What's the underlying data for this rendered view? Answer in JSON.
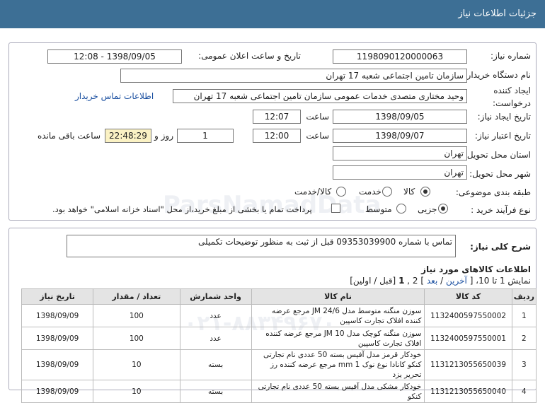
{
  "header": {
    "title": "جزئیات اطلاعات نیاز"
  },
  "form": {
    "need_number_label": "شماره نیاز:",
    "need_number": "1198090120000063",
    "announce_label": "تاریخ و ساعت اعلان عمومی:",
    "announce_value": "1398/09/05 - 12:08",
    "buyer_org_label": "نام دستگاه خریدار:",
    "buyer_org": "سازمان تامین اجتماعی شعبه 17 تهران",
    "creator_label_1": "ایجاد کننده",
    "creator_label_2": "درخواست:",
    "creator": "وحید  مختاری  متصدی خدمات عمومی  سازمان تامین اجتماعی شعبه 17 تهران",
    "contact_link": "اطلاعات تماس خریدار",
    "create_date_label": "تاریخ ایجاد نیاز:",
    "create_date": "1398/09/05",
    "time_label": "ساعت",
    "create_time": "12:07",
    "valid_date_label": "تاریخ اعتبار نیاز:",
    "valid_date": "1398/09/07",
    "valid_time": "12:00",
    "days_value": "1",
    "days_label": "روز و",
    "remaining_time": "22:48:29",
    "remaining_label": "ساعت باقی مانده",
    "province_label": "استان محل تحویل:",
    "province": "تهران",
    "city_label": "شهر محل تحویل:",
    "city": "تهران",
    "category_label": "طبقه بندی موضوعی:",
    "category_options": [
      "کالا",
      "خدمت",
      "کالا/خدمت"
    ],
    "category_selected": "کالا",
    "purchase_label": "نوع فرآیند خرید :",
    "purchase_options": [
      "جزیی",
      "متوسط"
    ],
    "purchase_selected": "جزیی",
    "payment_note": "پرداخت تمام یا بخشی از مبلغ خرید،از محل \"اسناد خزانه اسلامی\" خواهد بود."
  },
  "description": {
    "label": "شرح کلی نیاز:",
    "text": "تماس با شماره 09353039900 قبل از ثبت به منظور توضیحات تکمیلی"
  },
  "items_section": {
    "title": "اطلاعات کالاهای مورد نیاز",
    "pager_prefix": "نمایش 1 تا 10، [",
    "pager_last": "آخرین",
    "pager_sep1": "/",
    "pager_next": "بعد",
    "pager_mid": "] 2 ,",
    "pager_current": "1",
    "pager_suffix": "[قبل / اولین]",
    "columns": [
      "ردیف",
      "کد کالا",
      "نام کالا",
      "واحد شمارش",
      "تعداد / مقدار",
      "تاریخ نیاز"
    ],
    "rows": [
      {
        "row": "1",
        "code": "1132400597550002",
        "name": "سوزن منگنه متوسط مدل JM 24/6 مرجع عرضه کننده افلاک تجارت کاسپین",
        "unit": "عدد",
        "qty": "100",
        "date": "1398/09/09"
      },
      {
        "row": "2",
        "code": "1132400597550001",
        "name": "سوزن منگنه کوچک مدل JM 10 مرجع عرضه کننده افلاک تجارت کاسپین",
        "unit": "عدد",
        "qty": "100",
        "date": "1398/09/09"
      },
      {
        "row": "3",
        "code": "1131213055650039",
        "name": "خودکار قرمز مدل آفیس بسته 50 عددی نام تجارتی کنکو کانادا نوع نوک mm 1 مرجع عرضه کننده رز تحریر یزد",
        "unit": "بسته",
        "qty": "10",
        "date": "1398/09/09"
      },
      {
        "row": "4",
        "code": "1131213055650040",
        "name": "خودکار مشکی مدل آفیس بسته 50 عددی نام تجارتی کنکو",
        "unit": "بسته",
        "qty": "10",
        "date": "1398/09/09"
      }
    ]
  },
  "watermark": {
    "line1": "ParsNamadData",
    "line2": "۰۲۱-۸۸۳۴۹۶۷۰"
  },
  "colors": {
    "header_bg": "#3d6f95",
    "link": "#1a4fa0",
    "timer_bg": "#fbf2c4"
  }
}
